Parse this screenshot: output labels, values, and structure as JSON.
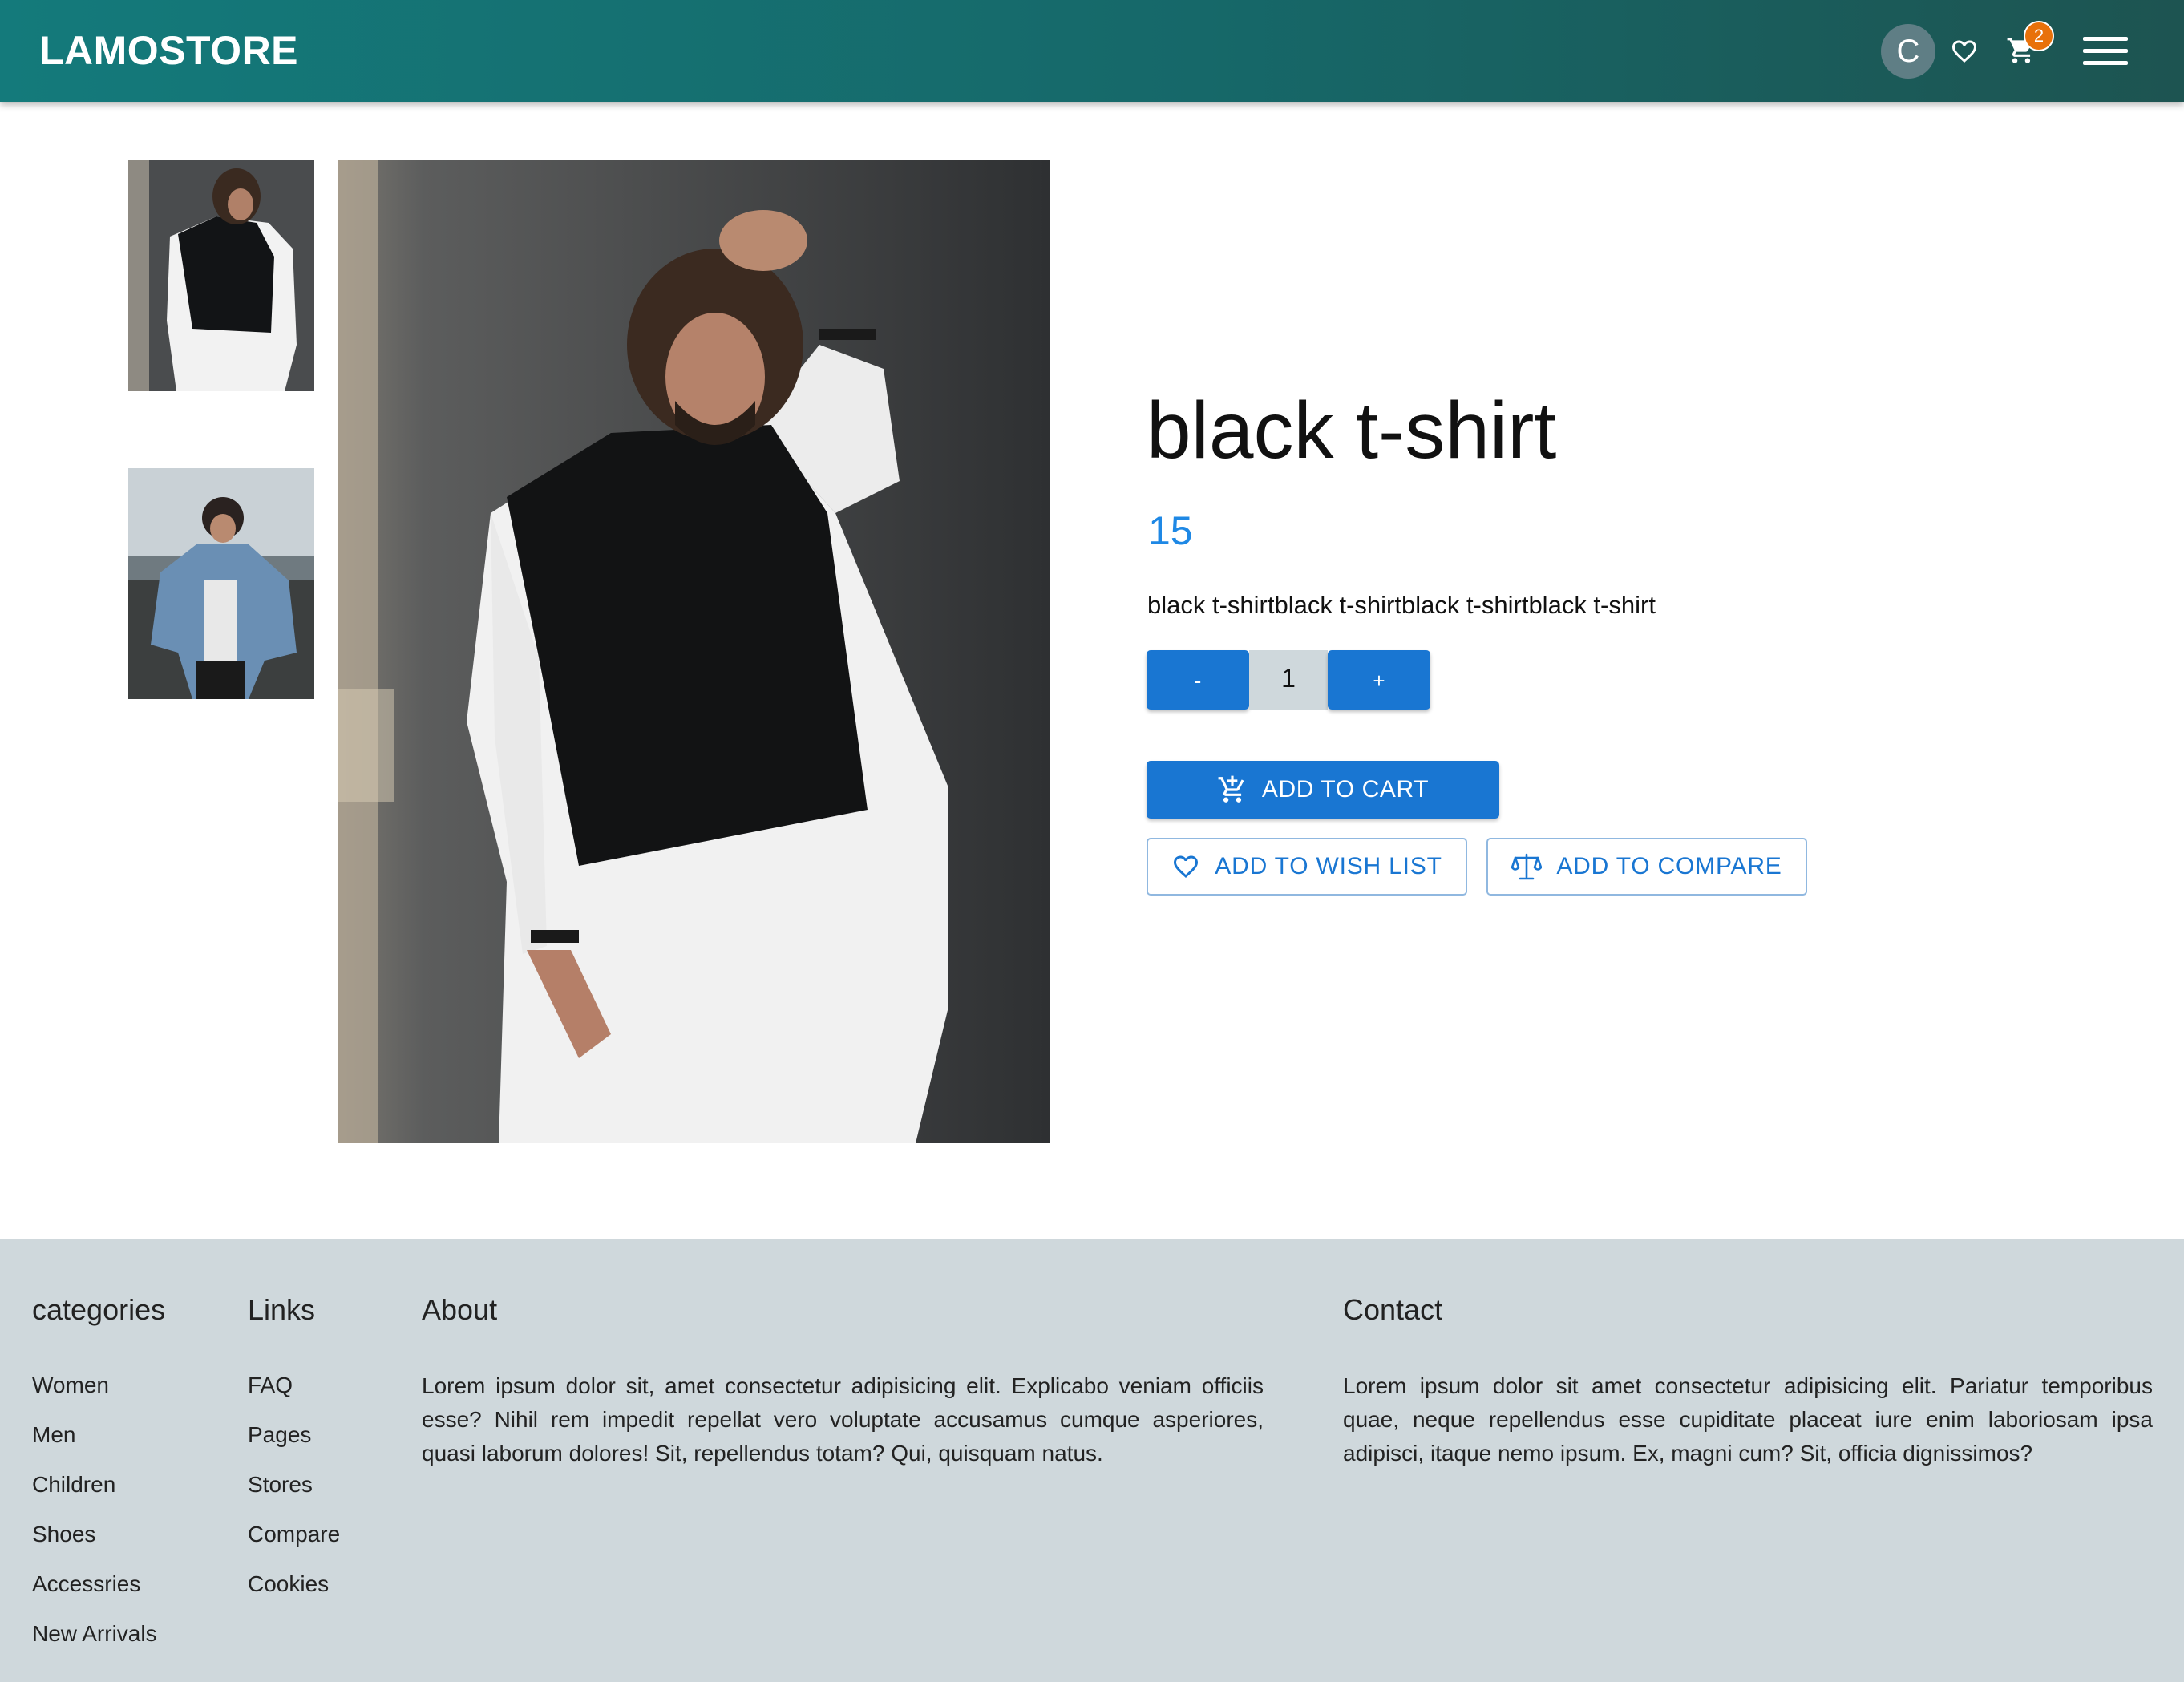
{
  "header": {
    "brand": "LAMOSTORE",
    "avatar_initial": "C",
    "cart_count": "2",
    "icons": [
      "heart-icon",
      "cart-icon",
      "menu-icon"
    ]
  },
  "product": {
    "title": "black t-shirt",
    "price": "15",
    "description": "black t-shirtblack t-shirtblack t-shirtblack t-shirt",
    "quantity": "1",
    "minus_label": "-",
    "plus_label": "+",
    "add_to_cart_label": "ADD TO CART",
    "add_to_wishlist_label": "ADD TO WISH LIST",
    "add_to_compare_label": "ADD TO COMPARE"
  },
  "footer": {
    "categories": {
      "heading": "categories",
      "items": [
        "Women",
        "Men",
        "Children",
        "Shoes",
        "Accessries",
        "New Arrivals"
      ]
    },
    "links": {
      "heading": "Links",
      "items": [
        "FAQ",
        "Pages",
        "Stores",
        "Compare",
        "Cookies"
      ]
    },
    "about": {
      "heading": "About",
      "text": "Lorem ipsum dolor sit, amet consectetur adipisicing elit. Explicabo veniam officiis esse? Nihil rem impedit repellat vero voluptate accusamus cumque asperiores, quasi laborum dolores! Sit, repellendus totam? Qui, quisquam natus."
    },
    "contact": {
      "heading": "Contact",
      "text": "Lorem ipsum dolor sit amet consectetur adipisicing elit. Pariatur temporibus quae, neque repellendus esse cupiditate placeat iure enim laboriosam ipsa adipisci, itaque nemo ipsum. Ex, magni cum? Sit, officia dignissimos?"
    }
  },
  "colors": {
    "header_start": "#147a7b",
    "header_end": "#1d5451",
    "primary": "#1976d2",
    "price": "#1e88e5",
    "badge": "#e8710a",
    "footer_bg": "#cfd8dc"
  }
}
